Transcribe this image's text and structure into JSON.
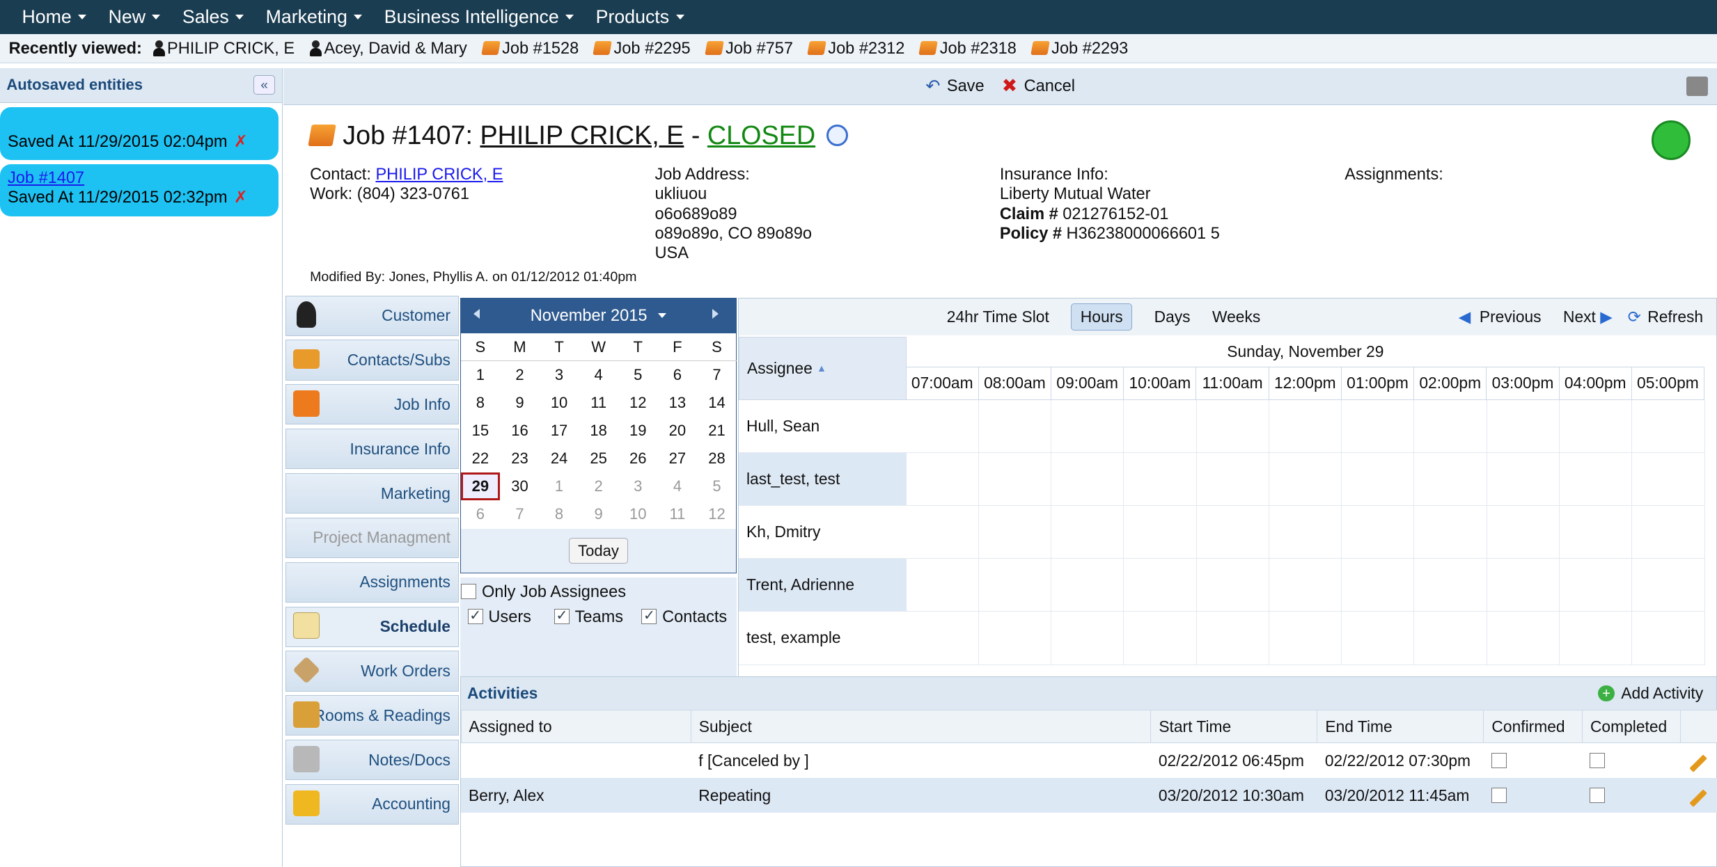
{
  "topnav": [
    {
      "label": "Home"
    },
    {
      "label": "New"
    },
    {
      "label": "Sales"
    },
    {
      "label": "Marketing"
    },
    {
      "label": "Business Intelligence"
    },
    {
      "label": "Products"
    }
  ],
  "recent": {
    "label": "Recently viewed:",
    "items": [
      {
        "type": "person",
        "label": "PHILIP CRICK, E"
      },
      {
        "type": "person",
        "label": "Acey, David & Mary"
      },
      {
        "type": "job",
        "label": "Job #1528"
      },
      {
        "type": "job",
        "label": "Job #2295"
      },
      {
        "type": "job",
        "label": "Job #757"
      },
      {
        "type": "job",
        "label": "Job #2312"
      },
      {
        "type": "job",
        "label": "Job #2318"
      },
      {
        "type": "job",
        "label": "Job #2293"
      }
    ]
  },
  "autosave": {
    "title": "Autosaved entities",
    "entries": [
      {
        "link": "",
        "saved": "Saved At 11/29/2015 02:04pm"
      },
      {
        "link": "Job #1407",
        "saved": "Saved At 11/29/2015 02:32pm"
      }
    ]
  },
  "toolbar": {
    "save": "Save",
    "cancel": "Cancel"
  },
  "job": {
    "prefix": "Job #1407:",
    "contact_name": "PHILIP CRICK, E",
    "sep": "-",
    "status": "CLOSED",
    "contact_label": "Contact:",
    "work": "Work: (804) 323-0761",
    "address_label": "Job Address:",
    "address": [
      "ukliuou",
      "o6o689o89",
      "o89o89o, CO 89o89o",
      "USA"
    ],
    "insurance_label": "Insurance Info:",
    "insurance_company": "Liberty Mutual Water",
    "claim_label": "Claim #",
    "claim": "021276152-01",
    "policy_label": "Policy #",
    "policy": "H36238000066601 5",
    "assignments_label": "Assignments:",
    "modified": "Modified By: Jones, Phyllis A. on 01/12/2012 01:40pm"
  },
  "tabs": [
    {
      "label": "Customer"
    },
    {
      "label": "Contacts/Subs"
    },
    {
      "label": "Job Info"
    },
    {
      "label": "Insurance Info"
    },
    {
      "label": "Marketing"
    },
    {
      "label": "Project Managment"
    },
    {
      "label": "Assignments"
    },
    {
      "label": "Schedule"
    },
    {
      "label": "Work Orders"
    },
    {
      "label": "Rooms & Readings"
    },
    {
      "label": "Notes/Docs"
    },
    {
      "label": "Accounting"
    }
  ],
  "calendar": {
    "month": "November 2015",
    "dow": [
      "S",
      "M",
      "T",
      "W",
      "T",
      "F",
      "S"
    ],
    "days": [
      "1",
      "2",
      "3",
      "4",
      "5",
      "6",
      "7",
      "8",
      "9",
      "10",
      "11",
      "12",
      "13",
      "14",
      "15",
      "16",
      "17",
      "18",
      "19",
      "20",
      "21",
      "22",
      "23",
      "24",
      "25",
      "26",
      "27",
      "28",
      "29",
      "30",
      "1",
      "2",
      "3",
      "4",
      "5",
      "6",
      "7",
      "8",
      "9",
      "10",
      "11",
      "12"
    ],
    "selected": "29",
    "today": "Today"
  },
  "filters": {
    "only": "Only Job Assignees",
    "users": "Users",
    "teams": "Teams",
    "contacts": "Contacts"
  },
  "schedule": {
    "slot": "24hr Time Slot",
    "hours": "Hours",
    "days": "Days",
    "weeks": "Weeks",
    "previous": "Previous",
    "next": "Next",
    "refresh": "Refresh",
    "assignee_header": "Assignee",
    "day": "Sunday, November 29",
    "hours_list": [
      "07:00am",
      "08:00am",
      "09:00am",
      "10:00am",
      "11:00am",
      "12:00pm",
      "01:00pm",
      "02:00pm",
      "03:00pm",
      "04:00pm",
      "05:00pm"
    ],
    "assignees": [
      "Hull, Sean",
      "last_test, test",
      "Kh, Dmitry",
      "Trent, Adrienne",
      "test, example"
    ]
  },
  "activities": {
    "title": "Activities",
    "add": "Add Activity",
    "columns": [
      "Assigned to",
      "Subject",
      "Start Time",
      "End Time",
      "Confirmed",
      "Completed"
    ],
    "rows": [
      {
        "assigned": "",
        "subject": "f [Canceled by ]",
        "start": "02/22/2012 06:45pm",
        "end": "02/22/2012 07:30pm"
      },
      {
        "assigned": "Berry, Alex",
        "subject": "Repeating",
        "start": "03/20/2012 10:30am",
        "end": "03/20/2012 11:45am"
      }
    ]
  }
}
